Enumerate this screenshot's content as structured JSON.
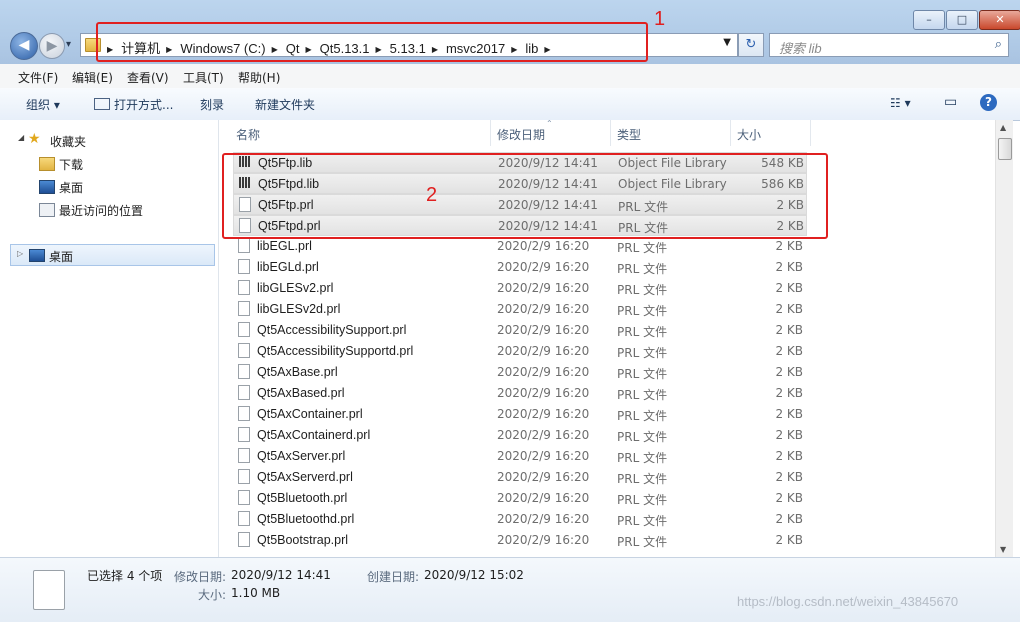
{
  "window": {
    "min_label": "–",
    "max_label": "□",
    "close_label": "✕"
  },
  "nav": {
    "back_glyph": "◀",
    "forward_glyph": "▶",
    "history_glyph": "▾"
  },
  "address": {
    "crumbs": [
      "计算机",
      "Windows7 (C:)",
      "Qt",
      "Qt5.13.1",
      "5.13.1",
      "msvc2017",
      "lib"
    ],
    "refresh_glyph": "↻"
  },
  "search": {
    "placeholder": "搜索 lib",
    "icon_glyph": "⌕"
  },
  "annotations": {
    "box1_label": "1",
    "box2_label": "2"
  },
  "menu": [
    "文件(F)",
    "编辑(E)",
    "查看(V)",
    "工具(T)",
    "帮助(H)"
  ],
  "toolbar": {
    "organize": "组织 ▾",
    "open_with": "打开方式...",
    "burn": "刻录",
    "new_folder": "新建文件夹",
    "views_glyph": "☷ ▾",
    "pane_glyph": "▭",
    "help_glyph": "?"
  },
  "navpane": {
    "favorites": "收藏夹",
    "downloads": "下载",
    "desktop": "桌面",
    "recent": "最近访问的位置",
    "desktop_root": "桌面"
  },
  "columns": {
    "name": "名称",
    "date": "修改日期",
    "type": "类型",
    "size": "大小"
  },
  "files": [
    {
      "name": "Qt5Ftp.lib",
      "date": "2020/9/12 14:41",
      "type": "Object File Library",
      "size": "548 KB",
      "icon": "lib-icon",
      "selected": true
    },
    {
      "name": "Qt5Ftpd.lib",
      "date": "2020/9/12 14:41",
      "type": "Object File Library",
      "size": "586 KB",
      "icon": "lib-icon",
      "selected": true
    },
    {
      "name": "Qt5Ftp.prl",
      "date": "2020/9/12 14:41",
      "type": "PRL 文件",
      "size": "2 KB",
      "icon": "file-icon",
      "selected": true
    },
    {
      "name": "Qt5Ftpd.prl",
      "date": "2020/9/12 14:41",
      "type": "PRL 文件",
      "size": "2 KB",
      "icon": "file-icon",
      "selected": true
    },
    {
      "name": "libEGL.prl",
      "date": "2020/2/9 16:20",
      "type": "PRL 文件",
      "size": "2 KB",
      "icon": "file-icon",
      "selected": false
    },
    {
      "name": "libEGLd.prl",
      "date": "2020/2/9 16:20",
      "type": "PRL 文件",
      "size": "2 KB",
      "icon": "file-icon",
      "selected": false
    },
    {
      "name": "libGLESv2.prl",
      "date": "2020/2/9 16:20",
      "type": "PRL 文件",
      "size": "2 KB",
      "icon": "file-icon",
      "selected": false
    },
    {
      "name": "libGLESv2d.prl",
      "date": "2020/2/9 16:20",
      "type": "PRL 文件",
      "size": "2 KB",
      "icon": "file-icon",
      "selected": false
    },
    {
      "name": "Qt5AccessibilitySupport.prl",
      "date": "2020/2/9 16:20",
      "type": "PRL 文件",
      "size": "2 KB",
      "icon": "file-icon",
      "selected": false
    },
    {
      "name": "Qt5AccessibilitySupportd.prl",
      "date": "2020/2/9 16:20",
      "type": "PRL 文件",
      "size": "2 KB",
      "icon": "file-icon",
      "selected": false
    },
    {
      "name": "Qt5AxBase.prl",
      "date": "2020/2/9 16:20",
      "type": "PRL 文件",
      "size": "2 KB",
      "icon": "file-icon",
      "selected": false
    },
    {
      "name": "Qt5AxBased.prl",
      "date": "2020/2/9 16:20",
      "type": "PRL 文件",
      "size": "2 KB",
      "icon": "file-icon",
      "selected": false
    },
    {
      "name": "Qt5AxContainer.prl",
      "date": "2020/2/9 16:20",
      "type": "PRL 文件",
      "size": "2 KB",
      "icon": "file-icon",
      "selected": false
    },
    {
      "name": "Qt5AxContainerd.prl",
      "date": "2020/2/9 16:20",
      "type": "PRL 文件",
      "size": "2 KB",
      "icon": "file-icon",
      "selected": false
    },
    {
      "name": "Qt5AxServer.prl",
      "date": "2020/2/9 16:20",
      "type": "PRL 文件",
      "size": "2 KB",
      "icon": "file-icon",
      "selected": false
    },
    {
      "name": "Qt5AxServerd.prl",
      "date": "2020/2/9 16:20",
      "type": "PRL 文件",
      "size": "2 KB",
      "icon": "file-icon",
      "selected": false
    },
    {
      "name": "Qt5Bluetooth.prl",
      "date": "2020/2/9 16:20",
      "type": "PRL 文件",
      "size": "2 KB",
      "icon": "file-icon",
      "selected": false
    },
    {
      "name": "Qt5Bluetoothd.prl",
      "date": "2020/2/9 16:20",
      "type": "PRL 文件",
      "size": "2 KB",
      "icon": "file-icon",
      "selected": false
    },
    {
      "name": "Qt5Bootstrap.prl",
      "date": "2020/2/9 16:20",
      "type": "PRL 文件",
      "size": "2 KB",
      "icon": "file-icon",
      "selected": false
    }
  ],
  "details": {
    "selection": "已选择 4 个项",
    "modified_label": "修改日期:",
    "modified_value": "2020/9/12 14:41",
    "created_label": "创建日期:",
    "created_value": "2020/9/12 15:02",
    "size_label": "大小:",
    "size_value": "1.10 MB"
  },
  "watermark": "https://blog.csdn.net/weixin_43845670",
  "colors": {
    "annotation_red": "#e02020",
    "accent_blue": "#2d5fa6"
  }
}
